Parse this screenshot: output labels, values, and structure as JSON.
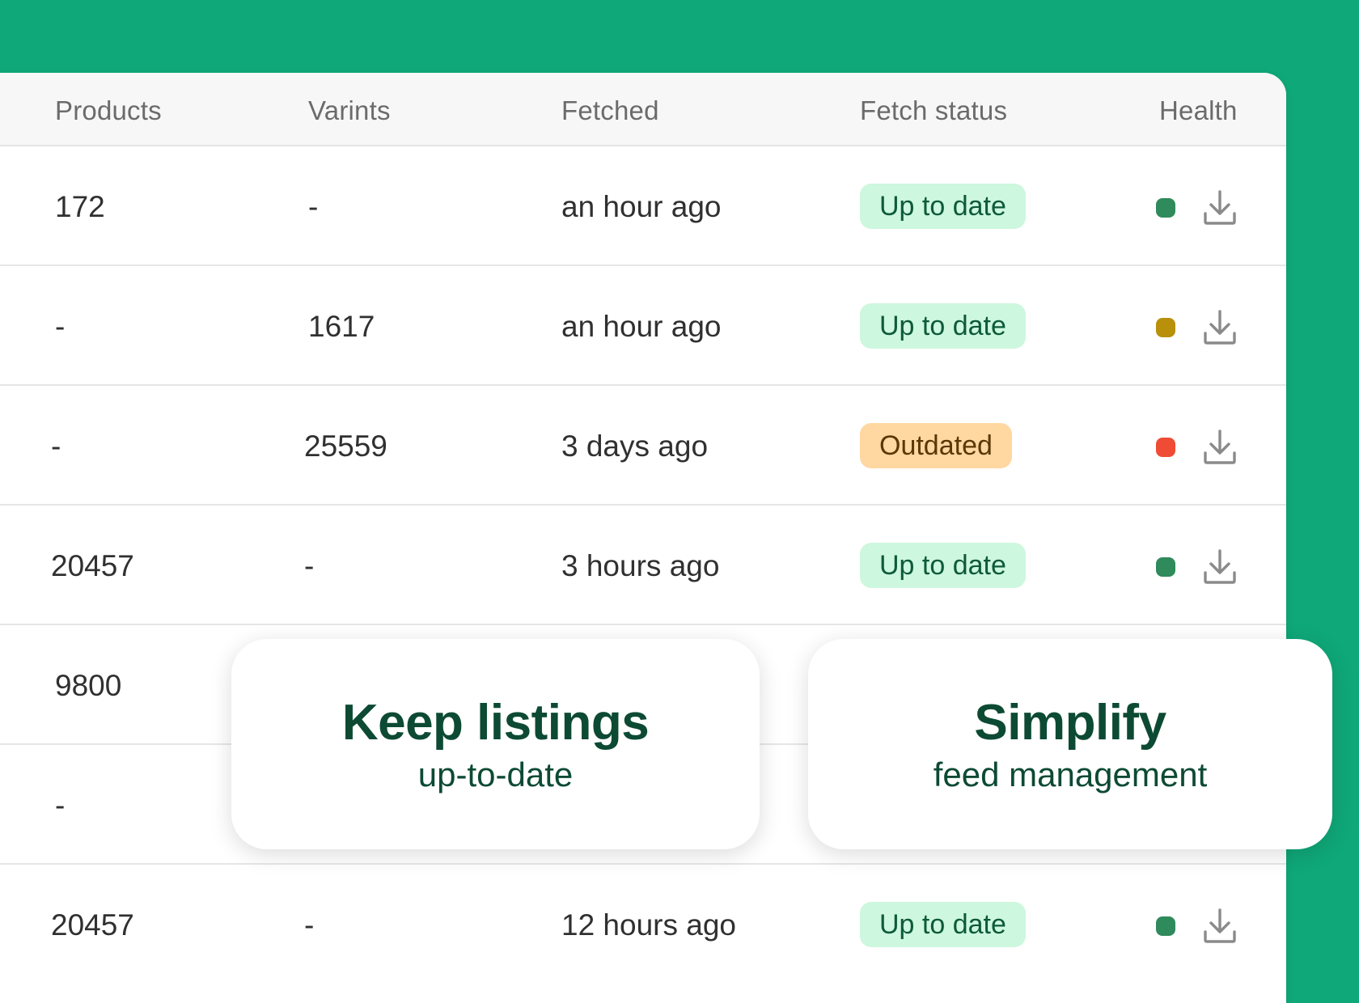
{
  "table": {
    "headers": [
      "Products",
      "Varints",
      "Fetched",
      "Fetch status",
      "Health"
    ],
    "rows": [
      {
        "products": "172",
        "variants": "-",
        "fetched": "an hour ago",
        "status": "Up to date",
        "status_type": "ok",
        "health_color": "#2f8a5c"
      },
      {
        "products": "-",
        "variants": "1617",
        "fetched": "an hour ago",
        "status": "Up to date",
        "status_type": "ok",
        "health_color": "#b8900a"
      },
      {
        "products": "-",
        "variants": "25559",
        "fetched": "3 days ago",
        "status": "Outdated",
        "status_type": "old",
        "health_color": "#ef4b35"
      },
      {
        "products": "20457",
        "variants": "-",
        "fetched": "3 hours ago",
        "status": "Up to date",
        "status_type": "ok",
        "health_color": "#2f8a5c"
      },
      {
        "products": "9800",
        "variants": "",
        "fetched": "",
        "status": "",
        "status_type": "",
        "health_color": ""
      },
      {
        "products": "-",
        "variants": "",
        "fetched": "",
        "status": "",
        "status_type": "",
        "health_color": ""
      },
      {
        "products": "20457",
        "variants": "-",
        "fetched": "12 hours ago",
        "status": "Up to date",
        "status_type": "ok",
        "health_color": "#2f8a5c"
      }
    ]
  },
  "cards": {
    "keep": {
      "title": "Keep listings",
      "subtitle": "up-to-date"
    },
    "simplify": {
      "title": "Simplify",
      "subtitle": "feed management"
    }
  },
  "icons": {
    "download": "download-icon"
  },
  "colors": {
    "background": "#0fa878",
    "badge_ok": "#cdf7de",
    "badge_outdated": "#ffd7a1",
    "card_text": "#0d4a34"
  }
}
